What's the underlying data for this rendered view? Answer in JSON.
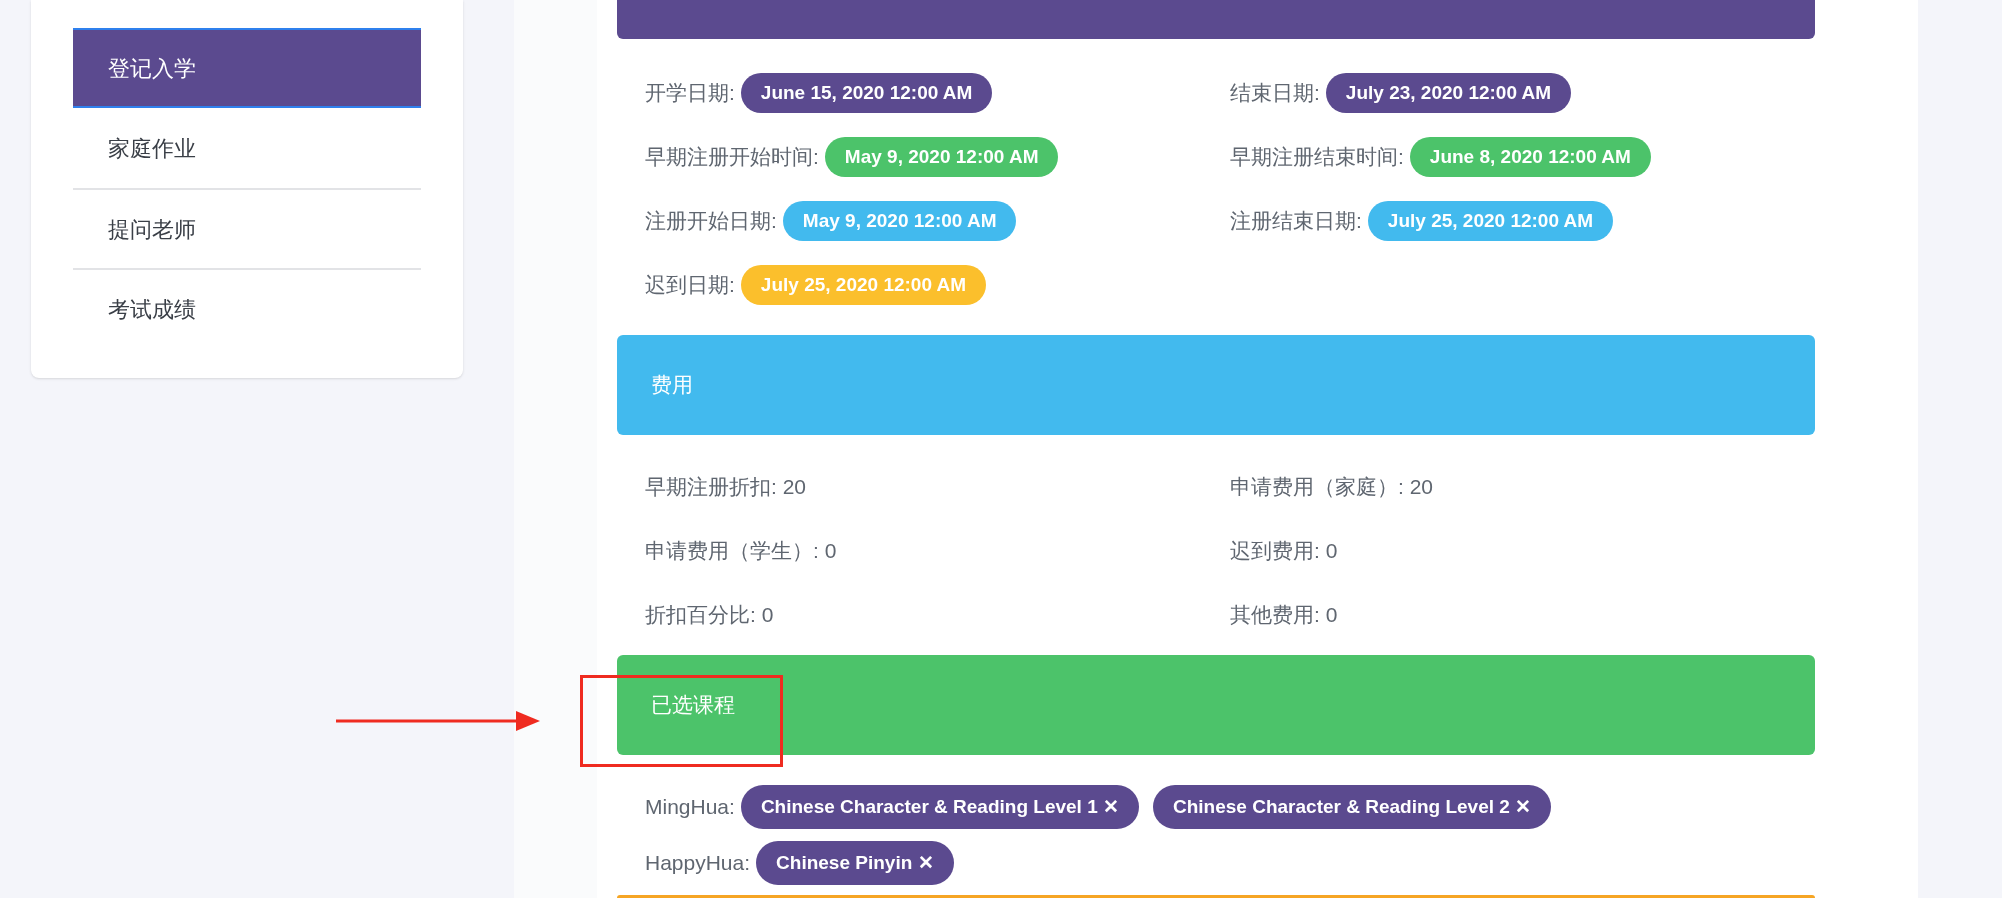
{
  "sidebar": {
    "items": [
      {
        "label": "登记入学",
        "selected": true
      },
      {
        "label": "家庭作业",
        "selected": false
      },
      {
        "label": "提问老师",
        "selected": false
      },
      {
        "label": "考试成绩",
        "selected": false
      }
    ]
  },
  "dates": {
    "color": "#5b4a8f",
    "fields": [
      {
        "label": "开学日期:",
        "value": "June 15, 2020 12:00 AM",
        "color": "#5b4a8f"
      },
      {
        "label": "结束日期:",
        "value": "July 23, 2020 12:00 AM",
        "color": "#5b4a8f"
      },
      {
        "label": "早期注册开始时间:",
        "value": "May 9, 2020 12:00 AM",
        "color": "#4cc36a"
      },
      {
        "label": "早期注册结束时间:",
        "value": "June 8, 2020 12:00 AM",
        "color": "#4cc36a"
      },
      {
        "label": "注册开始日期:",
        "value": "May 9, 2020 12:00 AM",
        "color": "#42baee"
      },
      {
        "label": "注册结束日期:",
        "value": "July 25, 2020 12:00 AM",
        "color": "#42baee"
      },
      {
        "label": "迟到日期:",
        "value": "July 25, 2020 12:00 AM",
        "color": "#fbbf2c"
      }
    ]
  },
  "fees": {
    "title": "费用",
    "color": "#42baee",
    "fields": [
      "早期注册折扣: 20",
      "申请费用（家庭）: 20",
      "申请费用（学生）: 0",
      "迟到费用: 0",
      "折扣百分比: 0",
      "其他费用: 0"
    ]
  },
  "courses": {
    "title": "已选课程",
    "color": "#4cc36a",
    "groups": [
      {
        "label": "MingHua:",
        "courses": [
          "Chinese Character & Reading Level 1 ✕",
          "Chinese Character & Reading Level 2 ✕"
        ]
      },
      {
        "label": "HappyHua:",
        "courses": [
          "Chinese Pinyin ✕"
        ]
      }
    ]
  }
}
